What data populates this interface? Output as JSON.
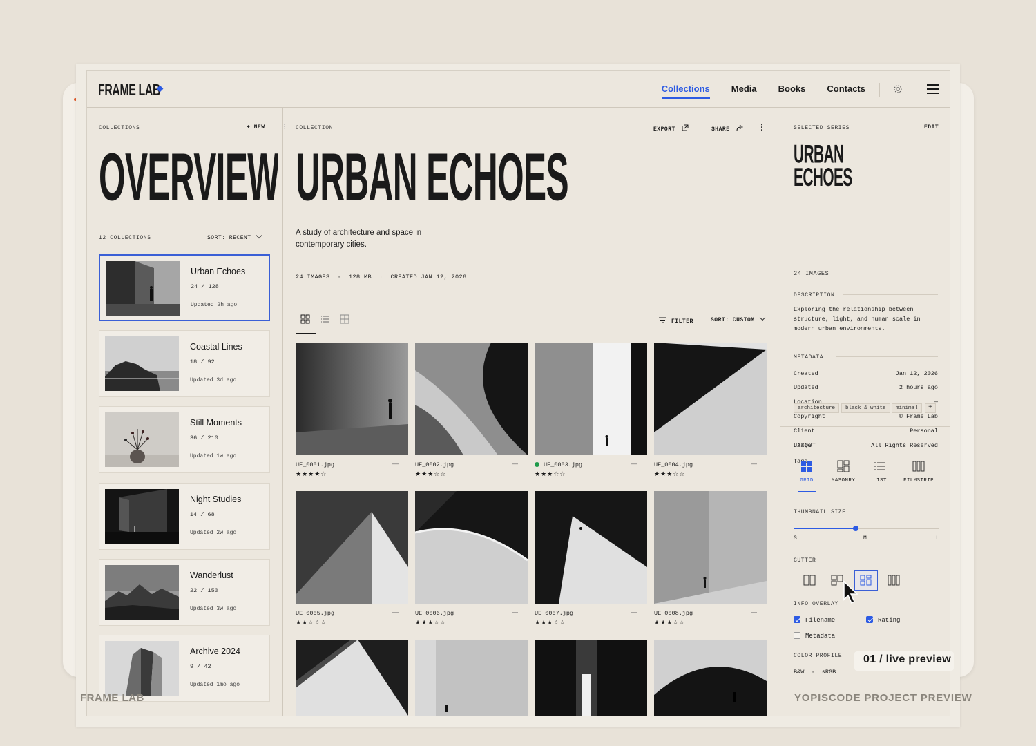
{
  "brand": {
    "logo": "FRAME LAB",
    "accent": "#2d5be3"
  },
  "nav": {
    "items": [
      {
        "label": "Collections",
        "active": true
      },
      {
        "label": "Media"
      },
      {
        "label": "Books"
      },
      {
        "label": "Contacts"
      }
    ]
  },
  "sidebar": {
    "section_label": "COLLECTIONS",
    "new_label": "+ NEW",
    "title": "OVERVIEW",
    "count_label": "12 COLLECTIONS",
    "sort_label": "SORT: RECENT",
    "collections": [
      {
        "name": "Urban Echoes",
        "count": "24 / 128",
        "updated": "Updated 2h ago",
        "active": true
      },
      {
        "name": "Coastal Lines",
        "count": "18 / 92",
        "updated": "Updated 3d ago"
      },
      {
        "name": "Still Moments",
        "count": "36 / 210",
        "updated": "Updated 1w ago"
      },
      {
        "name": "Night Studies",
        "count": "14 / 68",
        "updated": "Updated 2w ago"
      },
      {
        "name": "Wanderlust",
        "count": "22 / 150",
        "updated": "Updated 3w ago"
      },
      {
        "name": "Archive 2024",
        "count": "9 / 42",
        "updated": "Updated 1mo ago"
      }
    ]
  },
  "main": {
    "section_label": "COLLECTION",
    "export_label": "EXPORT",
    "share_label": "SHARE",
    "title": "URBAN ECHOES",
    "description": "A study of architecture and space in contemporary cities.",
    "meta": "24 IMAGES  ·  128 MB  ·  CREATED JAN 12, 2026",
    "filter_label": "FILTER",
    "sort_label": "SORT: CUSTOM",
    "images": [
      {
        "file": "UE_0001.jpg",
        "rating": 4
      },
      {
        "file": "UE_0002.jpg",
        "rating": 3
      },
      {
        "file": "UE_0003.jpg",
        "rating": 3,
        "flag": "green"
      },
      {
        "file": "UE_0004.jpg",
        "rating": 3
      },
      {
        "file": "UE_0005.jpg",
        "rating": 2
      },
      {
        "file": "UE_0006.jpg",
        "rating": 3
      },
      {
        "file": "UE_0007.jpg",
        "rating": 3
      },
      {
        "file": "UE_0008.jpg",
        "rating": 3
      }
    ],
    "dash": "—"
  },
  "right": {
    "section_label": "SELECTED SERIES",
    "edit_label": "EDIT",
    "title_line1": "URBAN",
    "title_line2": "ECHOES",
    "image_count": "24 IMAGES",
    "description_label": "DESCRIPTION",
    "description": "Exploring the relationship between structure, light, and human scale in modern urban environments.",
    "metadata_label": "METADATA",
    "metadata": [
      {
        "key": "Created",
        "value": "Jan 12, 2026"
      },
      {
        "key": "Updated",
        "value": "2 hours ago"
      },
      {
        "key": "Location",
        "value": "—"
      },
      {
        "key": "Copyright",
        "value": "© Frame Lab"
      },
      {
        "key": "Client",
        "value": "Personal"
      },
      {
        "key": "Usage",
        "value": "All Rights Reserved"
      },
      {
        "key": "Tags",
        "value": ""
      }
    ],
    "tags": [
      "architecture",
      "black & white",
      "minimal"
    ],
    "tag_add": "+",
    "layout_label": "LAYOUT",
    "layouts": [
      {
        "label": "GRID",
        "active": true
      },
      {
        "label": "MASONRY"
      },
      {
        "label": "LIST"
      },
      {
        "label": "FILMSTRIP"
      }
    ],
    "thumb_label": "THUMBNAIL SIZE",
    "thumb_value": 0.43,
    "thumb_s": "S",
    "thumb_m": "M",
    "thumb_l": "L",
    "gutter_label": "GUTTER",
    "gutter_active_index": 2,
    "overlay_label": "INFO OVERLAY",
    "overlay": [
      {
        "label": "Filename",
        "checked": true
      },
      {
        "label": "Rating",
        "checked": true
      },
      {
        "label": "Metadata",
        "checked": false
      }
    ],
    "color_label": "COLOR PROFILE",
    "color_value": "B&W  ·  sRGB"
  },
  "badge": "01 / live preview",
  "watermark_left": "FRAME LAB",
  "watermark_right": "YOPISCODE PROJECT PREVIEW"
}
